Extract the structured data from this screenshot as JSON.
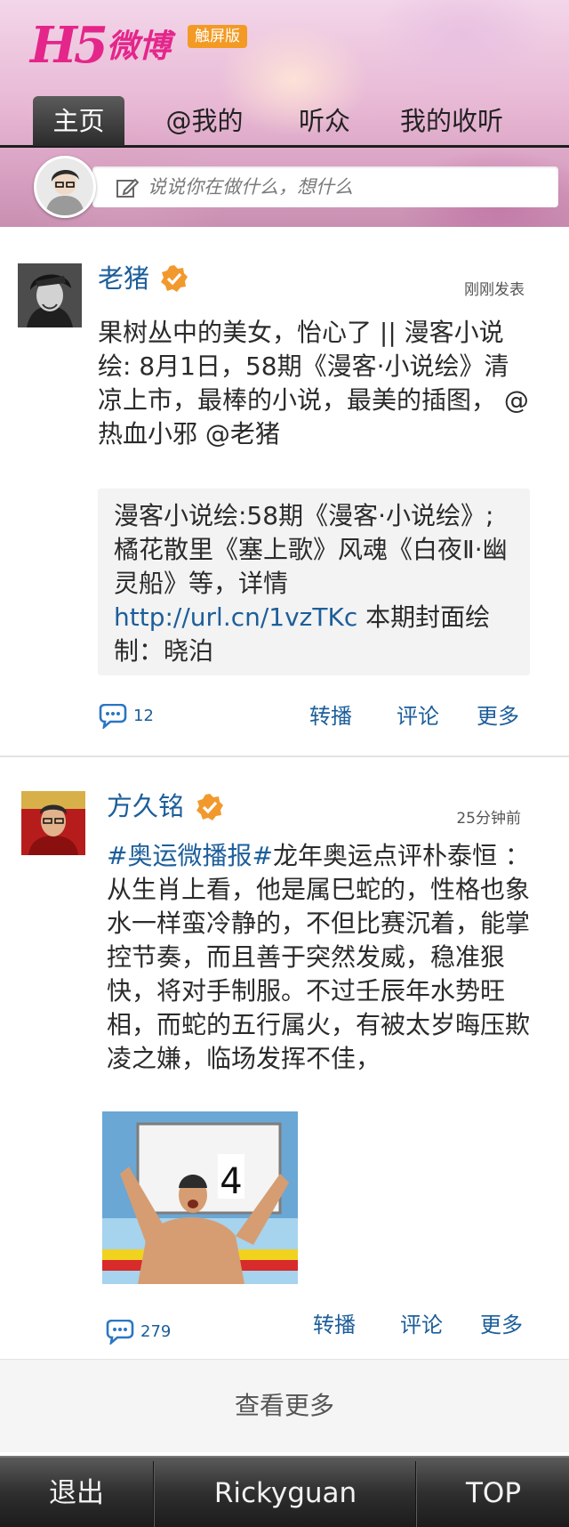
{
  "header": {
    "logo_h5": "H5",
    "logo_weibo": "微博",
    "badge": "触屏版"
  },
  "nav": {
    "items": [
      {
        "label": "主页",
        "active": true
      },
      {
        "label": "@我的",
        "active": false
      },
      {
        "label": "听众",
        "active": false
      },
      {
        "label": "我的收听",
        "active": false
      }
    ]
  },
  "compose": {
    "placeholder": "说说你在做什么，想什么"
  },
  "posts": [
    {
      "author": "老猪",
      "verified": true,
      "time": "刚刚发表",
      "text": "果树丛中的美女，怡心了 || 漫客小说绘: 8月1日，58期《漫客·小说绘》清凉上市，最棒的小说，最美的插图， @热血小邪 @老猪",
      "quote_text_1": "漫客小说绘:58期《漫客·小说绘》;橘花散里《塞上歌》风魂《白夜Ⅱ·幽灵船》等，详情",
      "quote_link": "http://url.cn/1vzTKc",
      "quote_text_2": " 本期封面绘制：晓泊",
      "comments": "12",
      "actions": {
        "repost": "转播",
        "comment": "评论",
        "more": "更多"
      }
    },
    {
      "author": "方久铭",
      "verified": true,
      "time": "25分钟前",
      "hashtag": "#奥运微播报#",
      "text": "龙年奥运点评朴泰恒 ： 从生肖上看，他是属巳蛇的，性格也象水一样蛮冷静的，不但比赛沉着，能掌控节奏，而且善于突然发威，稳准狠快，将对手制服。不过壬辰年水势旺相，而蛇的五行属火，有被太岁晦压欺凌之嫌，临场发挥不佳，",
      "photo_lane_number": "4",
      "comments": "279",
      "actions": {
        "repost": "转播",
        "comment": "评论",
        "more": "更多"
      }
    }
  ],
  "load_more": "查看更多",
  "footer": {
    "logout": "退出",
    "username": "Rickyguan",
    "top": "TOP"
  },
  "colors": {
    "link_blue": "#1c5e9a",
    "brand_pink": "#e4268b",
    "badge_orange": "#f39a24"
  }
}
